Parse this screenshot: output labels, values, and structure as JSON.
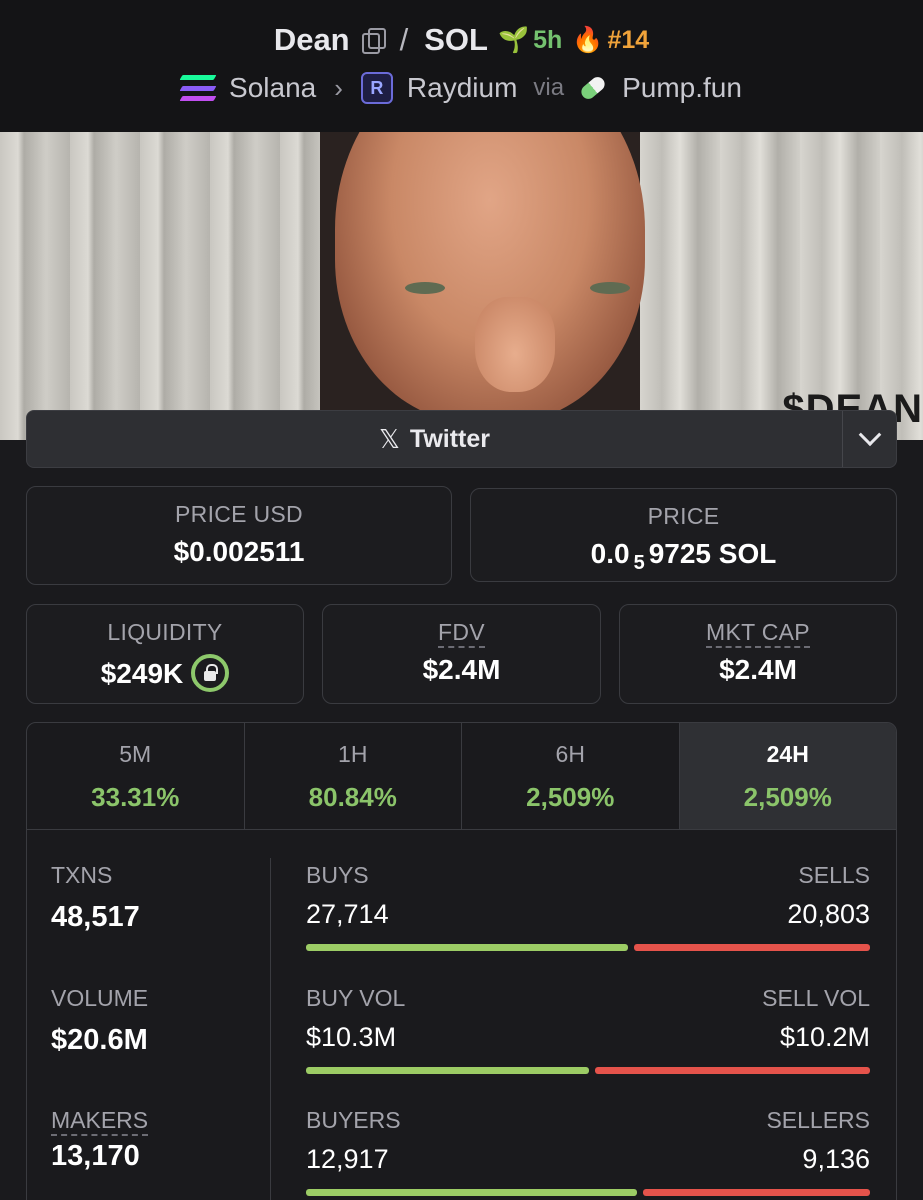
{
  "header": {
    "token_name": "Dean",
    "quote_symbol": "SOL",
    "age": "5h",
    "rank": "#14",
    "chain": "Solana",
    "dex": "Raydium",
    "via_label": "via",
    "launchpad": "Pump.fun"
  },
  "banner": {
    "ticker_text": "$DEAN"
  },
  "social": {
    "label": "Twitter"
  },
  "price_usd": {
    "label": "PRICE USD",
    "value": "$0.002511"
  },
  "price_native": {
    "label": "PRICE",
    "prefix": "0.0",
    "zeros": "5",
    "digits": "9725",
    "unit": "SOL"
  },
  "liquidity": {
    "label": "LIQUIDITY",
    "value": "$249K"
  },
  "fdv": {
    "label": "FDV",
    "value": "$2.4M"
  },
  "mkt_cap": {
    "label": "MKT CAP",
    "value": "$2.4M"
  },
  "periods": [
    {
      "label": "5M",
      "value": "33.31%"
    },
    {
      "label": "1H",
      "value": "80.84%"
    },
    {
      "label": "6H",
      "value": "2,509%"
    },
    {
      "label": "24H",
      "value": "2,509%",
      "active": true
    }
  ],
  "txns": {
    "label": "TXNS",
    "value": "48,517"
  },
  "volume": {
    "label": "VOLUME",
    "value": "$20.6M"
  },
  "makers": {
    "label": "MAKERS",
    "value": "13,170"
  },
  "buys": {
    "label": "BUYS",
    "value": "27,714",
    "sell_label": "SELLS",
    "sell_value": "20,803",
    "buy_fraction": 0.571
  },
  "vol_split": {
    "label": "BUY VOL",
    "value": "$10.3M",
    "sell_label": "SELL VOL",
    "sell_value": "$10.2M",
    "buy_fraction": 0.502
  },
  "buyers": {
    "label": "BUYERS",
    "value": "12,917",
    "sell_label": "SELLERS",
    "sell_value": "9,136",
    "buy_fraction": 0.586
  },
  "colors": {
    "positive": "#8bc46a",
    "buy_bar": "#9ccc65",
    "sell_bar": "#e5534b",
    "age": "#74c26f",
    "rank": "#f0a33a"
  }
}
